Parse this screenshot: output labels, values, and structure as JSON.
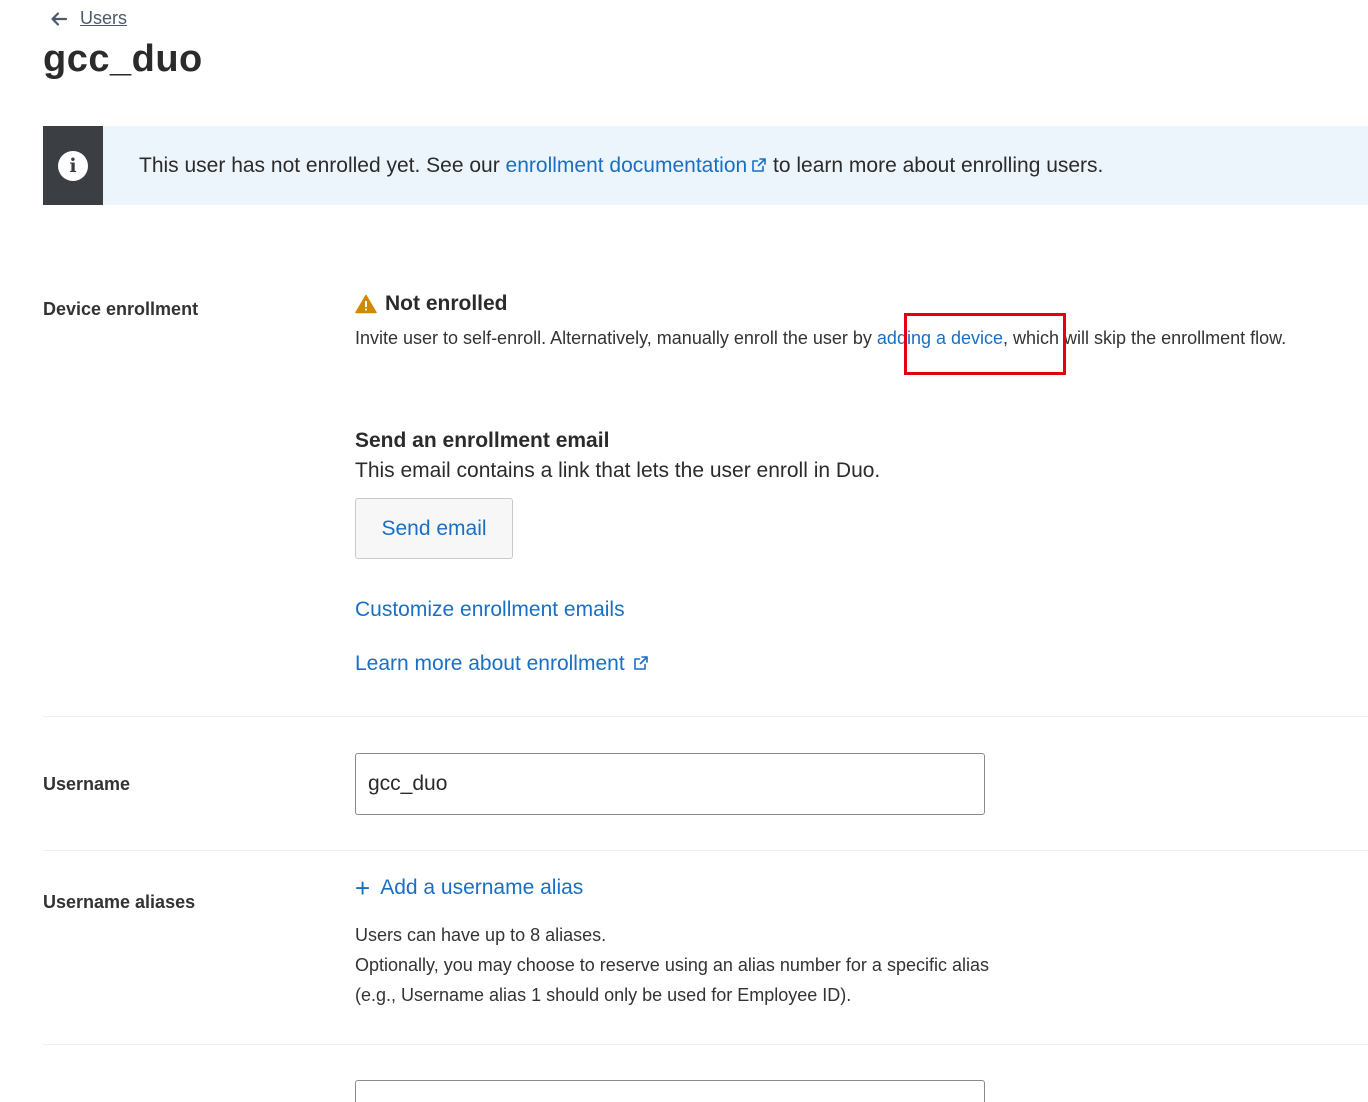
{
  "breadcrumb": {
    "back_label": "Users"
  },
  "page": {
    "title": "gcc_duo"
  },
  "banner": {
    "text_before": "This user has not enrolled yet. See our ",
    "link_text": "enrollment documentation",
    "text_after": " to learn more about enrolling users."
  },
  "device_enrollment": {
    "label": "Device enrollment",
    "status": "Not enrolled",
    "desc_before": "Invite user to self-enroll. Alternatively, manually enroll the user by ",
    "desc_link": "adding a device",
    "desc_after": ", which will skip the enrollment flow.",
    "send_title": "Send an enrollment email",
    "send_desc": "This email contains a link that lets the user enroll in Duo.",
    "send_button": "Send email",
    "customize_link": "Customize enrollment emails",
    "learn_link": "Learn more about enrollment"
  },
  "username": {
    "label": "Username",
    "value": "gcc_duo"
  },
  "aliases": {
    "label": "Username aliases",
    "add_link": "Add a username alias",
    "help_line1": "Users can have up to 8 aliases.",
    "help_line2": "Optionally, you may choose to reserve using an alias number for a specific alias",
    "help_line3": "(e.g., Username alias 1 should only be used for Employee ID)."
  },
  "colors": {
    "link": "#1a6fc4",
    "banner_bg": "#edf5fc",
    "banner_icon_bg": "#3b3f44",
    "warning": "#d08a00",
    "highlight": "#e3000f"
  }
}
